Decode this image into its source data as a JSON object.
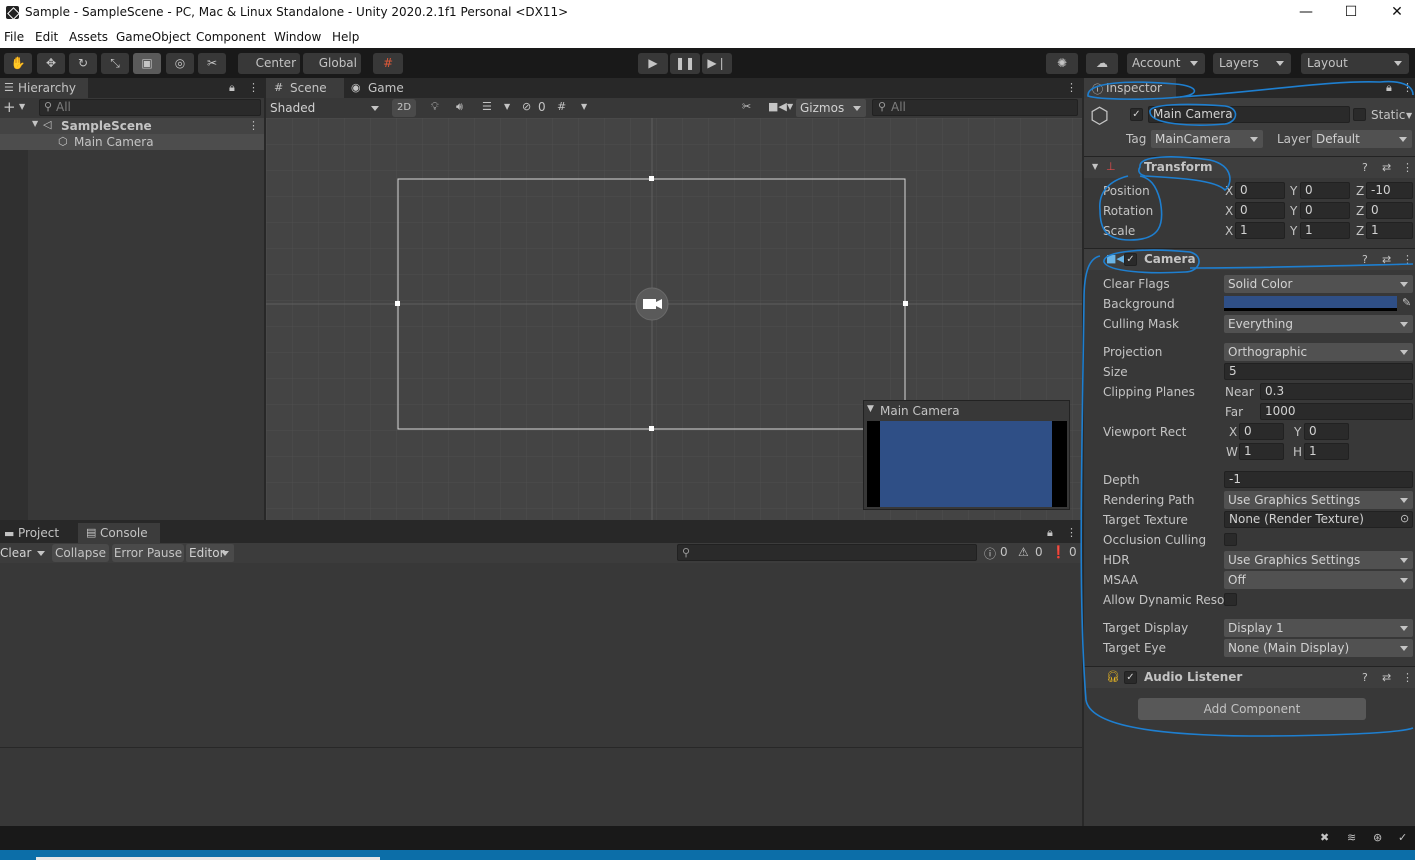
{
  "window": {
    "title": "Sample - SampleScene - PC, Mac & Linux Standalone - Unity 2020.2.1f1 Personal <DX11>",
    "min_glyph": "—",
    "max_glyph": "☐",
    "close_glyph": "✕"
  },
  "menu": [
    "File",
    "Edit",
    "Assets",
    "GameObject",
    "Component",
    "Window",
    "Help"
  ],
  "toolbar": {
    "pivot_label": "Center",
    "space_label": "Global",
    "account_label": "Account",
    "layers_label": "Layers",
    "layout_label": "Layout"
  },
  "hierarchy": {
    "tab_label": "Hierarchy",
    "search_placeholder": "All",
    "scene_name": "SampleScene",
    "items": [
      "Main Camera"
    ]
  },
  "scene": {
    "tabs": [
      "Scene",
      "Game"
    ],
    "shading_mode": "Shaded",
    "mode_2d": "2D",
    "hidden_count": "0",
    "gizmos_label": "Gizmos",
    "search_placeholder": "All",
    "camera_preview_title": "Main Camera",
    "preview_color": "#2f4f86"
  },
  "console": {
    "tabs": [
      "Project",
      "Console"
    ],
    "clear_label": "Clear",
    "collapse_label": "Collapse",
    "error_pause_label": "Error Pause",
    "editor_label": "Editor",
    "info_count": "0",
    "warn_count": "0",
    "error_count": "0"
  },
  "inspector": {
    "tab_label": "Inspector",
    "object_name": "Main Camera",
    "static_label": "Static",
    "tag_label": "Tag",
    "tag_value": "MainCamera",
    "layer_label": "Layer",
    "layer_value": "Default",
    "transform": {
      "title": "Transform",
      "rows": [
        {
          "label": "Position",
          "x": "0",
          "y": "0",
          "z": "-10"
        },
        {
          "label": "Rotation",
          "x": "0",
          "y": "0",
          "z": "0"
        },
        {
          "label": "Scale",
          "x": "1",
          "y": "1",
          "z": "1"
        }
      ]
    },
    "camera": {
      "title": "Camera",
      "clear_flags_label": "Clear Flags",
      "clear_flags": "Solid Color",
      "background_label": "Background",
      "background_color": "#2f4f86",
      "culling_mask_label": "Culling Mask",
      "culling_mask": "Everything",
      "projection_label": "Projection",
      "projection": "Orthographic",
      "size_label": "Size",
      "size": "5",
      "clipping_label": "Clipping Planes",
      "near_label": "Near",
      "near": "0.3",
      "far_label": "Far",
      "far": "1000",
      "viewport_label": "Viewport Rect",
      "vp_x": "0",
      "vp_y": "0",
      "vp_w": "1",
      "vp_h": "1",
      "depth_label": "Depth",
      "depth": "-1",
      "rendering_path_label": "Rendering Path",
      "rendering_path": "Use Graphics Settings",
      "target_texture_label": "Target Texture",
      "target_texture": "None (Render Texture)",
      "occlusion_label": "Occlusion Culling",
      "hdr_label": "HDR",
      "hdr": "Use Graphics Settings",
      "msaa_label": "MSAA",
      "msaa": "Off",
      "dynamic_res_label": "Allow Dynamic Resol",
      "target_display_label": "Target Display",
      "target_display": "Display 1",
      "target_eye_label": "Target Eye",
      "target_eye": "None (Main Display)"
    },
    "audio_listener_title": "Audio Listener",
    "add_component_label": "Add Component"
  },
  "axis_letters": {
    "x": "X",
    "y": "Y",
    "z": "Z",
    "w": "W",
    "h": "H"
  },
  "colors": {
    "annotation": "#1e7fd0",
    "accent_blue": "#2f4f86"
  }
}
